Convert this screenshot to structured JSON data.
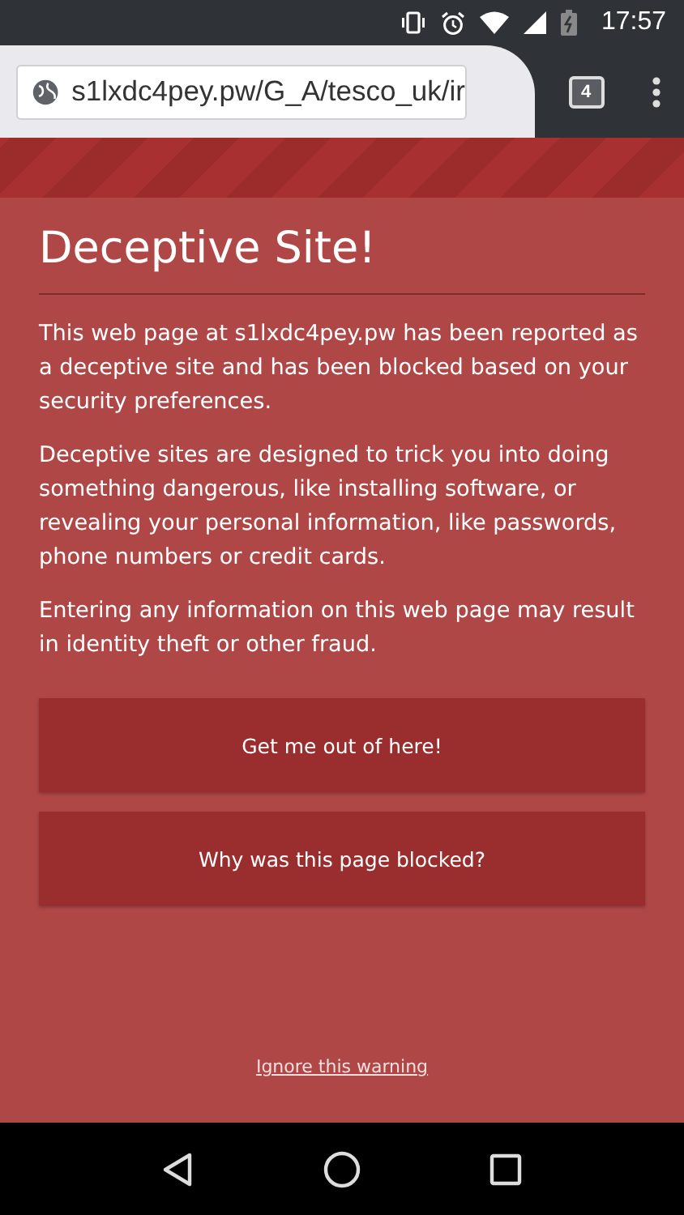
{
  "status_bar": {
    "time": "17:57"
  },
  "browser": {
    "url": "s1lxdc4pey.pw/G_A/tesco_uk/ir",
    "tab_count": "4"
  },
  "warning": {
    "title": "Deceptive Site!",
    "paragraphs": [
      "This web page at s1lxdc4pey.pw has been reported as a deceptive site and has been blocked based on your security preferences.",
      "Deceptive sites are designed to trick you into doing something dangerous, like installing software, or revealing your personal information, like passwords, phone numbers or credit cards.",
      "Entering any information on this web page may result in identity theft or other fraud."
    ],
    "buttons": [
      "Get me out of here!",
      "Why was this page blocked?"
    ],
    "ignore_link": "Ignore this warning"
  }
}
